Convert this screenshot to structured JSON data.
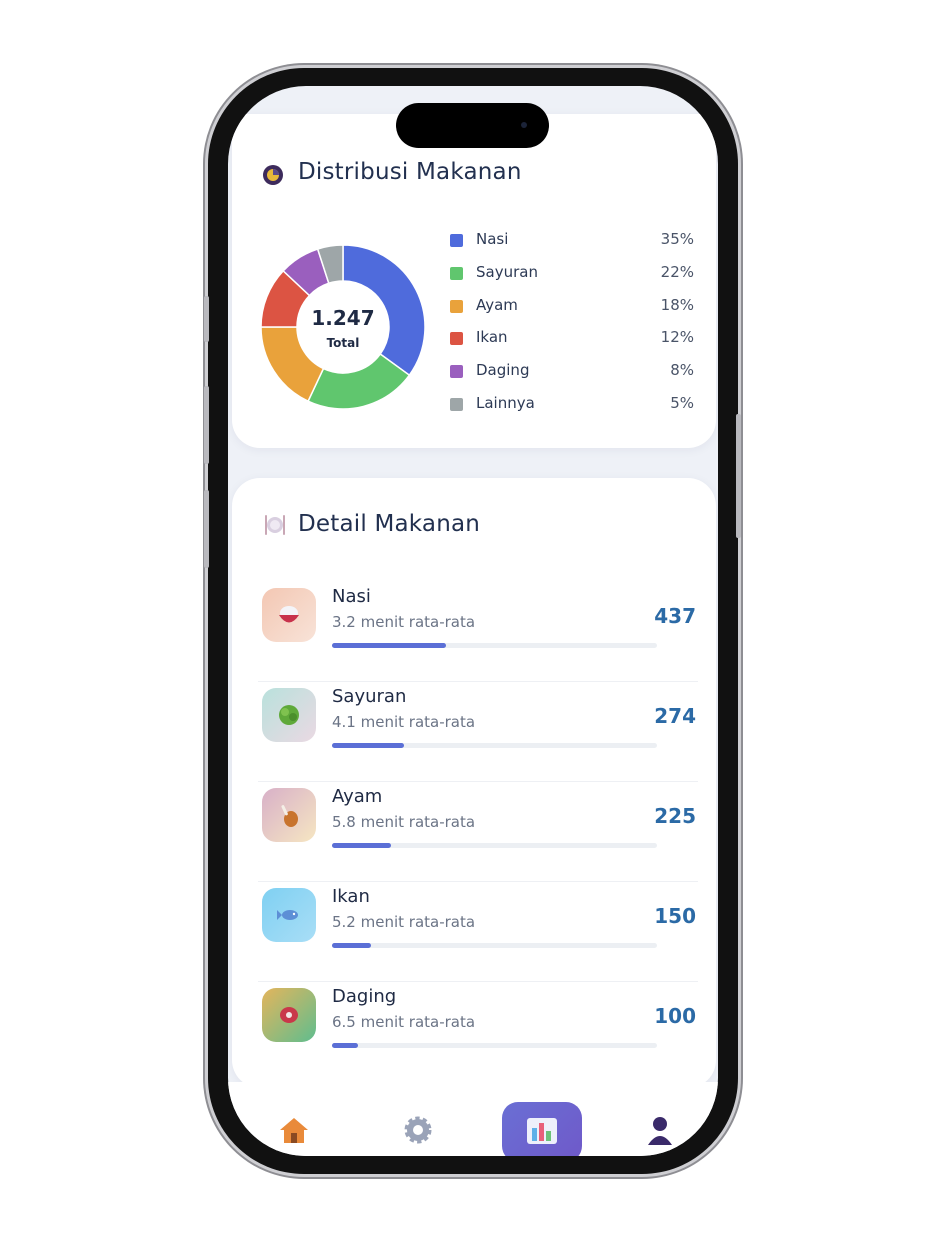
{
  "distribution": {
    "title": "Distribusi Makanan",
    "total_value": "1.247",
    "total_label": "Total",
    "items": [
      {
        "name": "Nasi",
        "pct_label": "35%",
        "color": "#4f6bdc"
      },
      {
        "name": "Sayuran",
        "pct_label": "22%",
        "color": "#60c66e"
      },
      {
        "name": "Ayam",
        "pct_label": "18%",
        "color": "#e9a23b"
      },
      {
        "name": "Ikan",
        "pct_label": "12%",
        "color": "#dc5443"
      },
      {
        "name": "Daging",
        "pct_label": "8%",
        "color": "#9a5fbe"
      },
      {
        "name": "Lainnya",
        "pct_label": "5%",
        "color": "#9ea6a8"
      }
    ]
  },
  "chart_data": {
    "type": "pie",
    "categories": [
      "Nasi",
      "Sayuran",
      "Ayam",
      "Ikan",
      "Daging",
      "Lainnya"
    ],
    "values": [
      35,
      22,
      18,
      12,
      8,
      5
    ]
  },
  "detail": {
    "title": "Detail Makanan",
    "items": [
      {
        "name": "Nasi",
        "sub": "3.2 menit rata-rata",
        "count": "437",
        "bar_fraction": 0.35,
        "icon": "rice-bowl-icon"
      },
      {
        "name": "Sayuran",
        "sub": "4.1 menit rata-rata",
        "count": "274",
        "bar_fraction": 0.22,
        "icon": "vegetable-icon"
      },
      {
        "name": "Ayam",
        "sub": "5.8 menit rata-rata",
        "count": "225",
        "bar_fraction": 0.18,
        "icon": "chicken-leg-icon"
      },
      {
        "name": "Ikan",
        "sub": "5.2 menit rata-rata",
        "count": "150",
        "bar_fraction": 0.12,
        "icon": "fish-icon"
      },
      {
        "name": "Daging",
        "sub": "6.5 menit rata-rata",
        "count": "100",
        "bar_fraction": 0.08,
        "icon": "meat-icon"
      }
    ]
  },
  "nav": {
    "items": [
      "home-icon",
      "gear-icon",
      "chart-icon",
      "profile-icon"
    ],
    "active": "chart-icon"
  }
}
